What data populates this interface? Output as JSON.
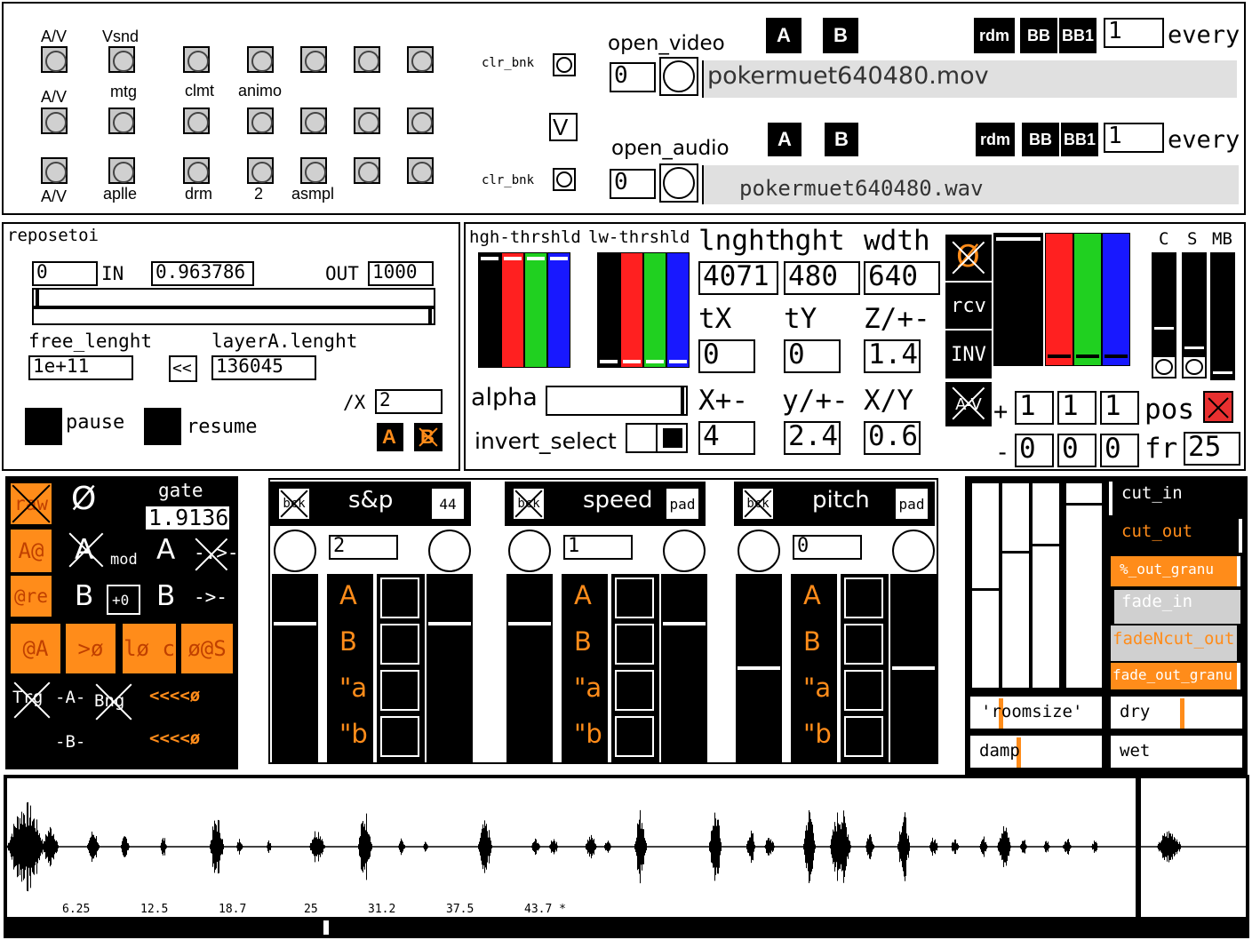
{
  "top": {
    "toggle_labels": [
      "A/V",
      "Vsnd",
      "A/V",
      "mtg",
      "clmt",
      "animo",
      "A/V",
      "aplle",
      "drm",
      "2",
      "asmpl"
    ],
    "clr_bnk": "clr_bnk",
    "v_label": "V",
    "open_video": "open_video",
    "open_audio": "open_audio",
    "video_num": "0",
    "audio_num": "0",
    "video_file": "pokermuet640480.mov",
    "audio_file": "pokermuet640480.wav",
    "btn_a": "A",
    "btn_b": "B",
    "rdm": "rdm",
    "bb": "BB",
    "bb1": "BB1",
    "every": "every",
    "every_val": "1"
  },
  "repos": {
    "title": "reposetoi",
    "in_val": "0",
    "in": "IN",
    "mid_val": "0.963786",
    "out": "OUT",
    "out_val": "1000",
    "free_lenght": "free_lenght",
    "layer_lenght": "layerA.lenght",
    "free_val": "1e+11",
    "back": "<<",
    "layer_val": "136045",
    "div": "/X",
    "div_val": "2",
    "pause": "pause",
    "resume": "resume",
    "a": "A",
    "b": "B"
  },
  "video": {
    "hgh": "hgh-thrshld",
    "lw": "lw-thrshld",
    "lnght": "lnght",
    "hght": "hght",
    "wdth": "wdth",
    "lnght_val": "4071",
    "hght_val": "480",
    "wdth_val": "640",
    "tx": "tX",
    "ty": "tY",
    "z": "Z/+-",
    "tx_val": "0",
    "ty_val": "0",
    "z_val": "1.4",
    "alpha": "alpha",
    "invert_select": "invert_select",
    "xpm": "X+-",
    "ypm": "y/+-",
    "xy": "X/Y",
    "xpm_val": "4",
    "ypm_val": "2.4",
    "xy_val": "0.6",
    "zero": "Ø",
    "rcv": "rcv",
    "inv": "INV",
    "av": "A-V",
    "c": "C",
    "s": "S",
    "mb": "MB",
    "plus": "+",
    "minus": "-",
    "p1": "1",
    "p2": "1",
    "p3": "1",
    "m1": "0",
    "m2": "0",
    "m3": "0",
    "pos": "pos",
    "fr": "fr",
    "fr_val": "25"
  },
  "left_ctrl": {
    "raw": "raw",
    "aat": "A@",
    "re": "@re",
    "zero": "Ø",
    "gate": "gate",
    "gate_val": "1.9136",
    "A": "A",
    "mod": "mod",
    "B": "B",
    "plus0": "+0",
    "arrow1": "-.>-",
    "arrow2": "->-",
    "atA": "@A",
    "to0": ">ø",
    "loc": "lø c",
    "zs": "ø@S",
    "trg": "Trg",
    "a_dash": "-A-",
    "bng": "Bng",
    "b_dash": "-B-",
    "rev1": "<<<<ø",
    "rev2": "<<<<ø"
  },
  "players": [
    {
      "title": "s&p",
      "tag": "44",
      "bck": "bck",
      "num": "2",
      "rows": [
        "A",
        "B",
        "\"a",
        "\"b"
      ]
    },
    {
      "title": "speed",
      "tag": "pad",
      "bck": "bck",
      "num": "1",
      "rows": [
        "A",
        "B",
        "\"a",
        "\"b"
      ]
    },
    {
      "title": "pitch",
      "tag": "pad",
      "bck": "bck",
      "num": "0",
      "rows": [
        "A",
        "B",
        "\"a",
        "\"b"
      ]
    }
  ],
  "reverb": {
    "cut_in": "cut_in",
    "cut_out": "cut_out",
    "out_granu": "%_out_granu",
    "fade_in": "fade_in",
    "fadencut_out": "fadeNcut_out",
    "fade_out_granu": "fade_out_granu",
    "roomsize": "'roomsize'",
    "dry": "dry",
    "damp": "damp",
    "wet": "wet"
  },
  "wave": {
    "ticks": [
      "6.25",
      "12.5",
      "18.7",
      "25",
      "31.2",
      "37.5",
      "43.7 *"
    ]
  }
}
